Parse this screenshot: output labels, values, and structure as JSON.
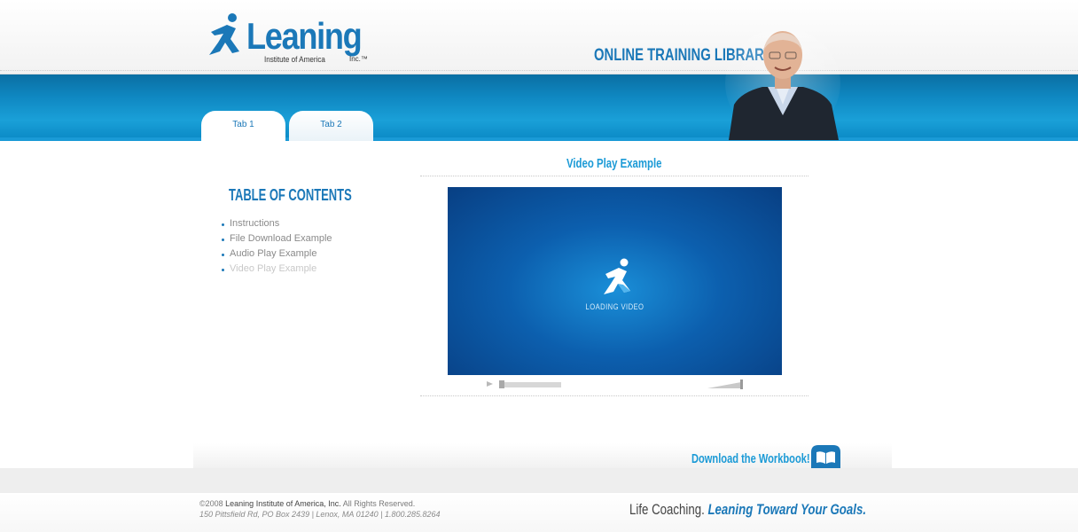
{
  "header": {
    "logo_word": "Leaning",
    "logo_sub": "Institute of America",
    "logo_inc": "Inc.™",
    "library_title": "ONLINE TRAINING LIBRARY"
  },
  "tabs": [
    {
      "label": "Tab 1",
      "active": true
    },
    {
      "label": "Tab 2",
      "active": false
    }
  ],
  "sidebar": {
    "title": "TABLE OF CONTENTS",
    "items": [
      {
        "label": "Instructions"
      },
      {
        "label": "File Download Example"
      },
      {
        "label": "Audio Play Example"
      },
      {
        "label": "Video Play Example",
        "current": true
      }
    ]
  },
  "main": {
    "title": "Video Play Example",
    "video_status": "LOADING VIDEO",
    "progress": 0
  },
  "workbook": {
    "label": "Download the Workbook!"
  },
  "footer": {
    "copyright_prefix": "©2008 ",
    "company": "Leaning Institute of America, Inc.",
    "rights": " All Rights Reserved.",
    "address": "150 Pittsfield Rd, PO Box 2439  |  Lenox, MA 01240  |  1.800.285.8264",
    "slogan_a": "Life Coaching. ",
    "slogan_b": "Leaning Toward Your Goals."
  },
  "colors": {
    "brand_blue": "#1b78b8",
    "accent_blue": "#1b9ad6"
  }
}
